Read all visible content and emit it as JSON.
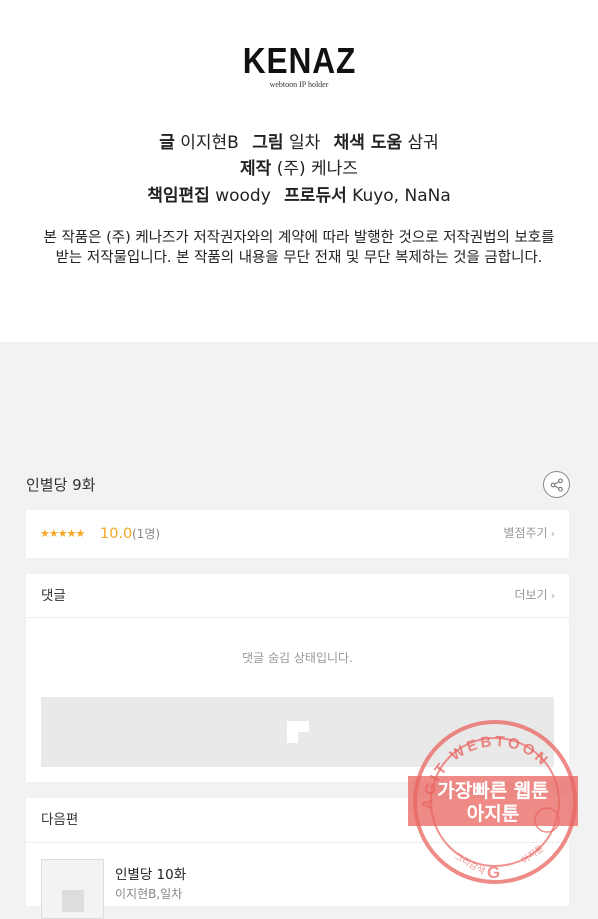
{
  "credits": {
    "logo_main": "KENAZ",
    "logo_sub": "webtoon IP holder",
    "writer_label": "글",
    "writer": "이지현B",
    "art_label": "그림",
    "art": "일차",
    "color_label": "채색 도움",
    "color": "삼궈",
    "production_label": "제작",
    "production": "(주) 케나즈",
    "editor_label": "책임편집",
    "editor": "woody",
    "producer_label": "프로듀서",
    "producer": "Kuyo, NaNa",
    "notice_line1": "본 작품은 (주) 케나즈가 저작권자와의 계약에 따라 발행한 것으로 저작권법의 보호를",
    "notice_line2": "받는 저작물입니다. 본 작품의 내용을 무단 전재 및 무단 복제하는 것을 금합니다."
  },
  "episode": {
    "title": "인별당 9화",
    "share_icon": "share-icon"
  },
  "rating": {
    "stars": "★★★★★",
    "value": "10.0",
    "count": "(1명)",
    "rate_link": "별점주기",
    "chevron": "›"
  },
  "comments": {
    "label": "댓글",
    "more_link": "더보기",
    "chevron": "›",
    "hidden_message": "댓글 숨김 상태입니다."
  },
  "next": {
    "label": "다음편",
    "title": "인별당 10화",
    "author": "이지현B,일차"
  },
  "watermark": {
    "ring_text": "AGIT WEBTOON",
    "line1": "가장빠른 웹툰",
    "line2": "아지툰",
    "bottom_left": "그리감색",
    "bottom_right": "아지툰",
    "color": "#e8645f"
  }
}
